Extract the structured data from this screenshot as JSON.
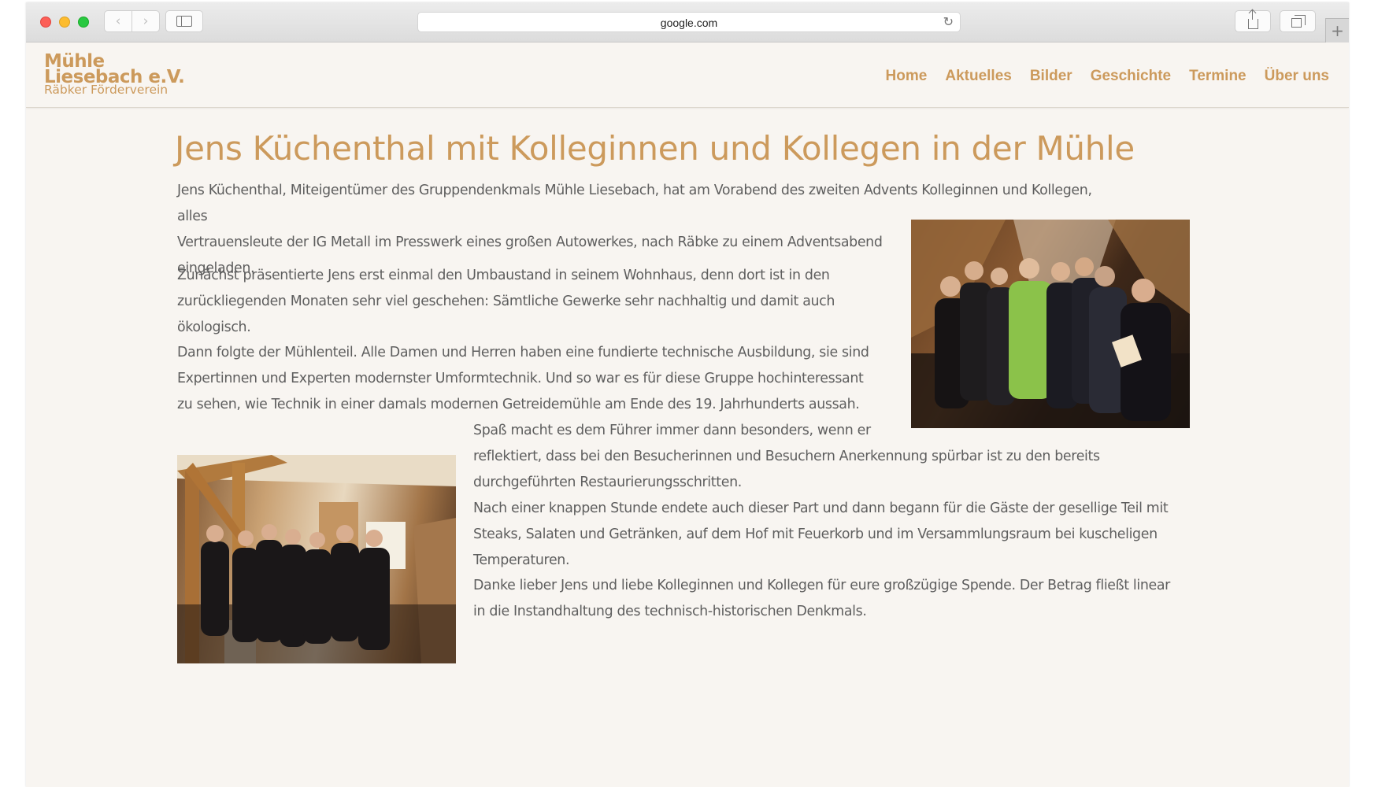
{
  "browser": {
    "address": "google.com"
  },
  "site": {
    "logo": {
      "line1": "Mühle",
      "line2": "Liesebach e.V.",
      "line3": "Räbker Förderverein"
    },
    "nav": [
      {
        "label": "Home"
      },
      {
        "label": "Aktuelles"
      },
      {
        "label": "Bilder"
      },
      {
        "label": "Geschichte"
      },
      {
        "label": "Termine"
      },
      {
        "label": "Über uns"
      }
    ],
    "accent_color": "#cc9a5c"
  },
  "article": {
    "title": "Jens Küchenthal mit Kolleginnen und Kollegen in der Mühle",
    "paragraphs": [
      "Jens Küchenthal, Miteigentümer des Gruppendenkmals Mühle Liesebach, hat am Vorabend des zweiten Advents Kolleginnen und Kollegen, alles Vertrauensleute der IG Metall im Presswerk eines großen Autowerkes, nach Räbke zu einem Adventsabend eingeladen.",
      "Zunächst präsentierte Jens erst einmal den Umbaustand in seinem Wohnhaus, denn dort ist in den zurückliegenden Monaten sehr viel geschehen: Sämtliche Gewerke sehr nachhaltig und damit auch ökologisch.",
      "Dann folgte der Mühlenteil. Alle Damen und Herren haben eine fundierte technische Ausbildung, sie sind Expertinnen und Experten modernster Umformtechnik. Und so war es für diese Gruppe hochinteressant zu sehen, wie Technik in einer damals modernen Getreidemühle am Ende des 19. Jahrhunderts aussah.",
      "Spaß macht es dem Führer immer dann besonders, wenn er reflektiert, dass bei den Besucherinnen und Besuchern Anerkennung spürbar ist zu den bereits durchgeführten Restaurierungsschritten.",
      "Nach einer knappen Stunde endete auch dieser Part und dann begann für die Gäste der gesellige Teil mit Steaks, Salaten und Getränken, auf dem Hof mit Feuerkorb und im Versammlungsraum bei kuscheligen Temperaturen.",
      "Danke lieber Jens und liebe Kolleginnen und Kollegen für eure großzügige Spende. Der Betrag fließt linear in die Instandhaltung des technisch-historischen Denkmals."
    ],
    "p1_lines": [
      "Jens Küchenthal, Miteigentümer des Gruppendenkmals Mühle Liesebach, hat am Vorabend des zweiten Advents Kolleginnen und Kollegen, alles",
      "Vertrauensleute der IG Metall im Presswerk eines großen Autowerkes, nach Räbke zu einem Adventsabend",
      "eingeladen."
    ],
    "p4_lines": [
      "Spaß macht es dem Führer immer dann besonders, wenn er",
      "reflektiert, dass bei den Besucherinnen und Besuchern Anerkennung spürbar ist zu den bereits",
      "durchgeführten Restaurierungsschritten."
    ]
  }
}
